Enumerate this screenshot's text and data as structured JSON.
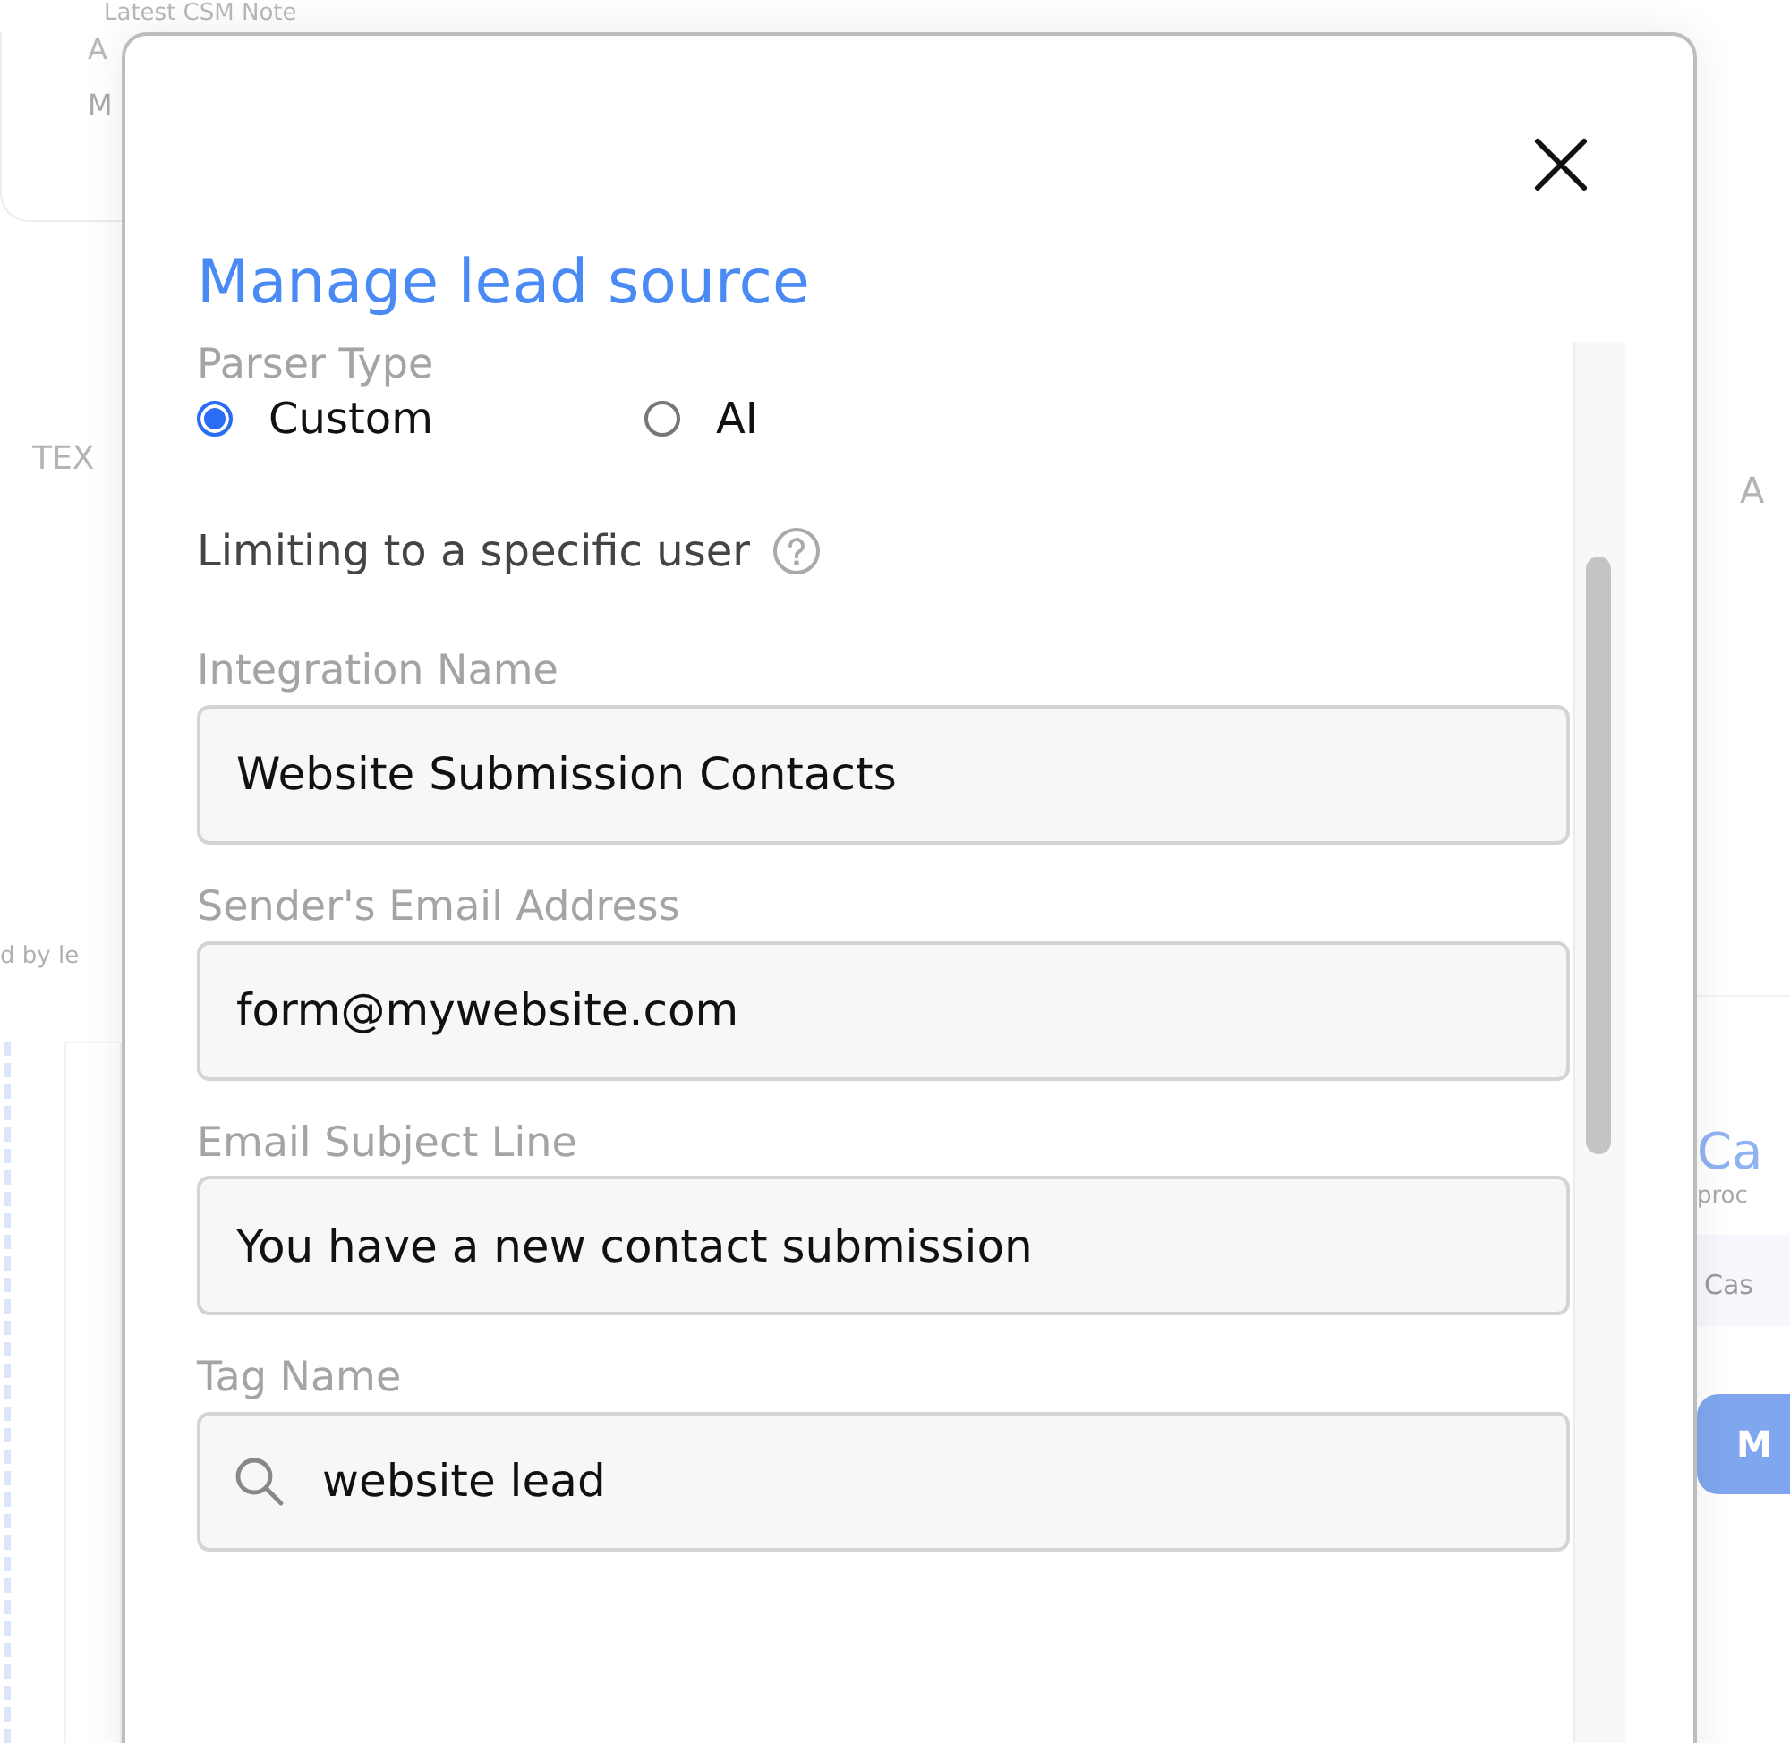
{
  "background_page": {
    "note_heading": "Latest CSM Note",
    "note_line_1": "A",
    "note_line_2": "M",
    "left_tab": "TEX",
    "right_tab": "A",
    "caption": "d by le",
    "card_title": "Ca",
    "card_text": "proc",
    "card_field": "Cas",
    "card_button": "M"
  },
  "modal": {
    "title": "Manage lead source",
    "parser_type": {
      "label": "Parser Type",
      "options": [
        {
          "label": "Custom",
          "selected": true
        },
        {
          "label": "AI",
          "selected": false
        }
      ]
    },
    "limit": {
      "label": "Limiting to a specific user"
    },
    "fields": [
      {
        "kind": "text",
        "label": "Integration Name",
        "value": "Website Submission Contacts"
      },
      {
        "kind": "text",
        "label": "Sender's Email Address",
        "value": "form@mywebsite.com"
      },
      {
        "kind": "text",
        "label": "Email Subject Line",
        "value": "You have a new contact submission"
      },
      {
        "kind": "search",
        "label": "Tag Name",
        "value": "website lead"
      }
    ]
  }
}
